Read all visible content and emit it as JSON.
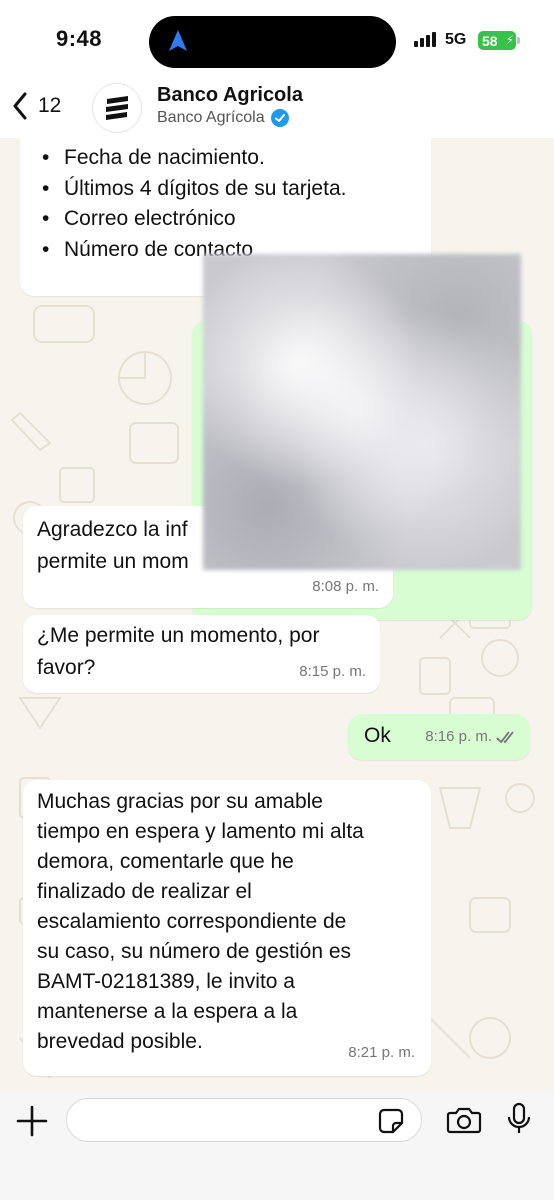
{
  "status_bar": {
    "time": "9:48",
    "network": "5G",
    "battery": "58",
    "icons": [
      "navigation-arrow-icon",
      "signal-icon",
      "battery-icon"
    ]
  },
  "header": {
    "back_count": "12",
    "title": "Banco Agricola",
    "subtitle": "Banco Agrícola",
    "icons": [
      "back-chevron-icon",
      "bank-logo-icon",
      "verified-badge-icon"
    ]
  },
  "messages": {
    "first": {
      "items": [
        "Fecha de nacimiento.",
        "Últimos 4 dígitos de su tarjeta.",
        "Correo electrónico",
        "Número de contacto"
      ]
    },
    "second": {
      "text": "Agradezco la información brindada, me permite un momento, por favor?",
      "visible_top": "Agradezco la inf",
      "visible_bottom": "permite un mom",
      "time": "8:08 p. m."
    },
    "third": {
      "line1": "¿Me permite un momento, por",
      "line2": "favor?",
      "time": "8:15 p. m."
    },
    "fourth": {
      "text": "Ok",
      "time": "8:16 p. m."
    },
    "fifth": {
      "lines": [
        "Muchas gracias por su amable",
        "tiempo en espera y lamento mi alta",
        "demora, comentarle que he",
        "finalizado de realizar el",
        "escalamiento correspondiente de",
        "su caso, su número de gestión es",
        "BAMT-02181389, le invito a",
        "mantenerse a la espera a la",
        "brevedad posible."
      ],
      "time": "8:21 p. m."
    }
  },
  "composer": {
    "placeholder": "",
    "icons": [
      "plus-icon",
      "sticker-icon",
      "camera-icon",
      "microphone-icon"
    ]
  },
  "colors": {
    "incoming_bubble": "#ffffff",
    "outgoing_bubble": "#d9fdd3",
    "chat_background": "#f7f4ee",
    "battery": "#37c24a",
    "verified": "#1d9bf0"
  }
}
